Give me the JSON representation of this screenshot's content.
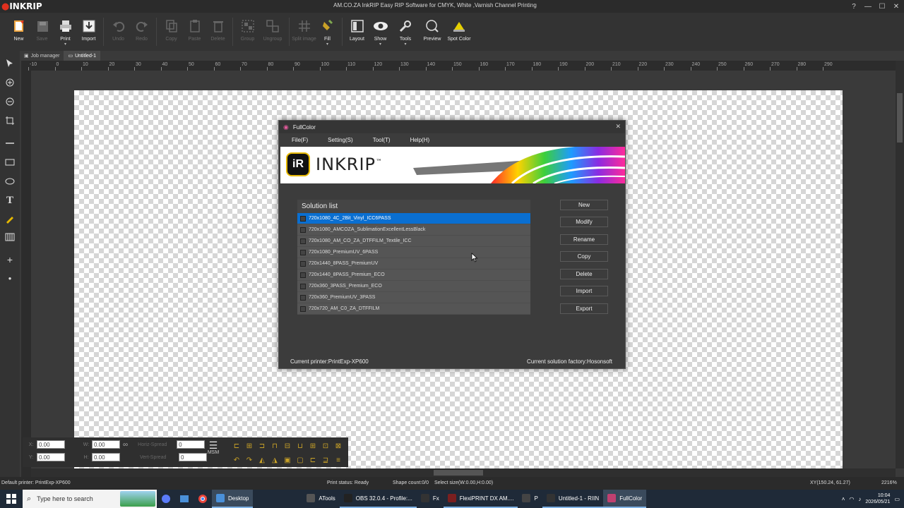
{
  "app": {
    "logo": "INKRIP",
    "window_title": "AM.CO.ZA InkRIP Easy RIP Software for CMYK, White ,Varnish Channel Printing"
  },
  "toolbar": [
    {
      "label": "New",
      "icon": "new-icon",
      "enabled": true
    },
    {
      "label": "Save",
      "icon": "save-icon",
      "enabled": false
    },
    {
      "label": "Print",
      "icon": "print-icon",
      "enabled": true
    },
    {
      "label": "Import",
      "icon": "import-icon",
      "enabled": true
    },
    {
      "label": "Undo",
      "icon": "undo-icon",
      "enabled": false
    },
    {
      "label": "Redo",
      "icon": "redo-icon",
      "enabled": false
    },
    {
      "label": "Copy",
      "icon": "copy-icon",
      "enabled": false
    },
    {
      "label": "Paste",
      "icon": "paste-icon",
      "enabled": false
    },
    {
      "label": "Delete",
      "icon": "delete-icon",
      "enabled": false
    },
    {
      "label": "Group",
      "icon": "group-icon",
      "enabled": false
    },
    {
      "label": "Ungroup",
      "icon": "ungroup-icon",
      "enabled": false
    },
    {
      "label": "Split image",
      "icon": "split-image-icon",
      "enabled": false
    },
    {
      "label": "Fill",
      "icon": "fill-icon",
      "enabled": true
    },
    {
      "label": "Layout",
      "icon": "layout-icon",
      "enabled": true
    },
    {
      "label": "Show",
      "icon": "show-icon",
      "enabled": true
    },
    {
      "label": "Tools",
      "icon": "tools-icon",
      "enabled": true
    },
    {
      "label": "Preview",
      "icon": "preview-icon",
      "enabled": true
    },
    {
      "label": "Spot Color",
      "icon": "spot-color-icon",
      "enabled": true
    }
  ],
  "tabs": {
    "job_manager": "Job manager",
    "untitled": "Untitled-1"
  },
  "ruler": [
    "-10",
    "0",
    "10",
    "20",
    "30",
    "40",
    "50",
    "60",
    "70",
    "80",
    "90",
    "100",
    "110",
    "120",
    "130",
    "140",
    "150",
    "160",
    "170",
    "180",
    "190",
    "200",
    "210",
    "220",
    "230",
    "240",
    "250",
    "260",
    "270",
    "280",
    "290"
  ],
  "coord_panel": {
    "x_label": "X:",
    "y_label": "Y:",
    "w_label": "W:",
    "h_label": "H:",
    "x": "0.00",
    "y": "0.00",
    "w": "0.00",
    "h": "0.00",
    "horiz_spread_label": "Horiz-Spread",
    "vert_spread_label": "Vert-Spread",
    "horiz_spread": "0",
    "vert_spread": "0",
    "msm": "MSM"
  },
  "status": {
    "default_printer": "Default printer: PrintExp-XP600",
    "print_status": "Print status: Ready",
    "shape_count": "Shape count:0/0",
    "select_size": "Select size(W:0.00,H:0.00)",
    "xy": "XY(150.24, 61.27)",
    "zoom": "2216%"
  },
  "dialog": {
    "title": "FullColor",
    "menu": [
      "File(F)",
      "Setting(S)",
      "Tool(T)",
      "Help(H)"
    ],
    "banner_badge": "iR",
    "banner_word": "INKRIP",
    "banner_tm": "™",
    "solution_list_title": "Solution list",
    "solutions": [
      "720x1080_4C_2Bit_Vinyl_ICC6PASS",
      "720x1080_AMCOZA_SublimationExcellentLessBlack",
      "720x1080_AM_CO_ZA_DTFFILM_Textile_ICC",
      "720x1080_PremiumUV_6PASS",
      "720x1440_8PASS_PremiumUV",
      "720x1440_8PASS_Premium_ECO",
      "720x360_3PASS_Premium_ECO",
      "720x360_PremiumUV_3PASS",
      "720x720_AM_C0_ZA_DTFFILM"
    ],
    "selected_index": 0,
    "buttons": [
      "New",
      "Modify",
      "Rename",
      "Copy",
      "Delete",
      "Import",
      "Export"
    ],
    "current_printer": "Current printer:PrintExp-XP600",
    "solution_factory": "Current solution factory:Hosonsoft"
  },
  "taskbar": {
    "search_placeholder": "Type here to search",
    "apps": [
      {
        "label": "Desktop",
        "state": "active"
      },
      {
        "label": "ATools",
        "state": "normal"
      },
      {
        "label": "OBS 32.0.4 - Profile:...",
        "state": "open"
      },
      {
        "label": "Fx",
        "state": "normal"
      },
      {
        "label": "FlexiPRINT DX AM....",
        "state": "open"
      },
      {
        "label": "P",
        "state": "normal"
      },
      {
        "label": "Untitled-1 - RIIN",
        "state": "open"
      },
      {
        "label": "FullColor",
        "state": "active"
      }
    ],
    "time": "10:04",
    "date": "2026/05/21"
  },
  "colors": {
    "selection": "#0a6fd1",
    "accent_yellow": "#e6b800",
    "logo_red": "#e0301e"
  }
}
